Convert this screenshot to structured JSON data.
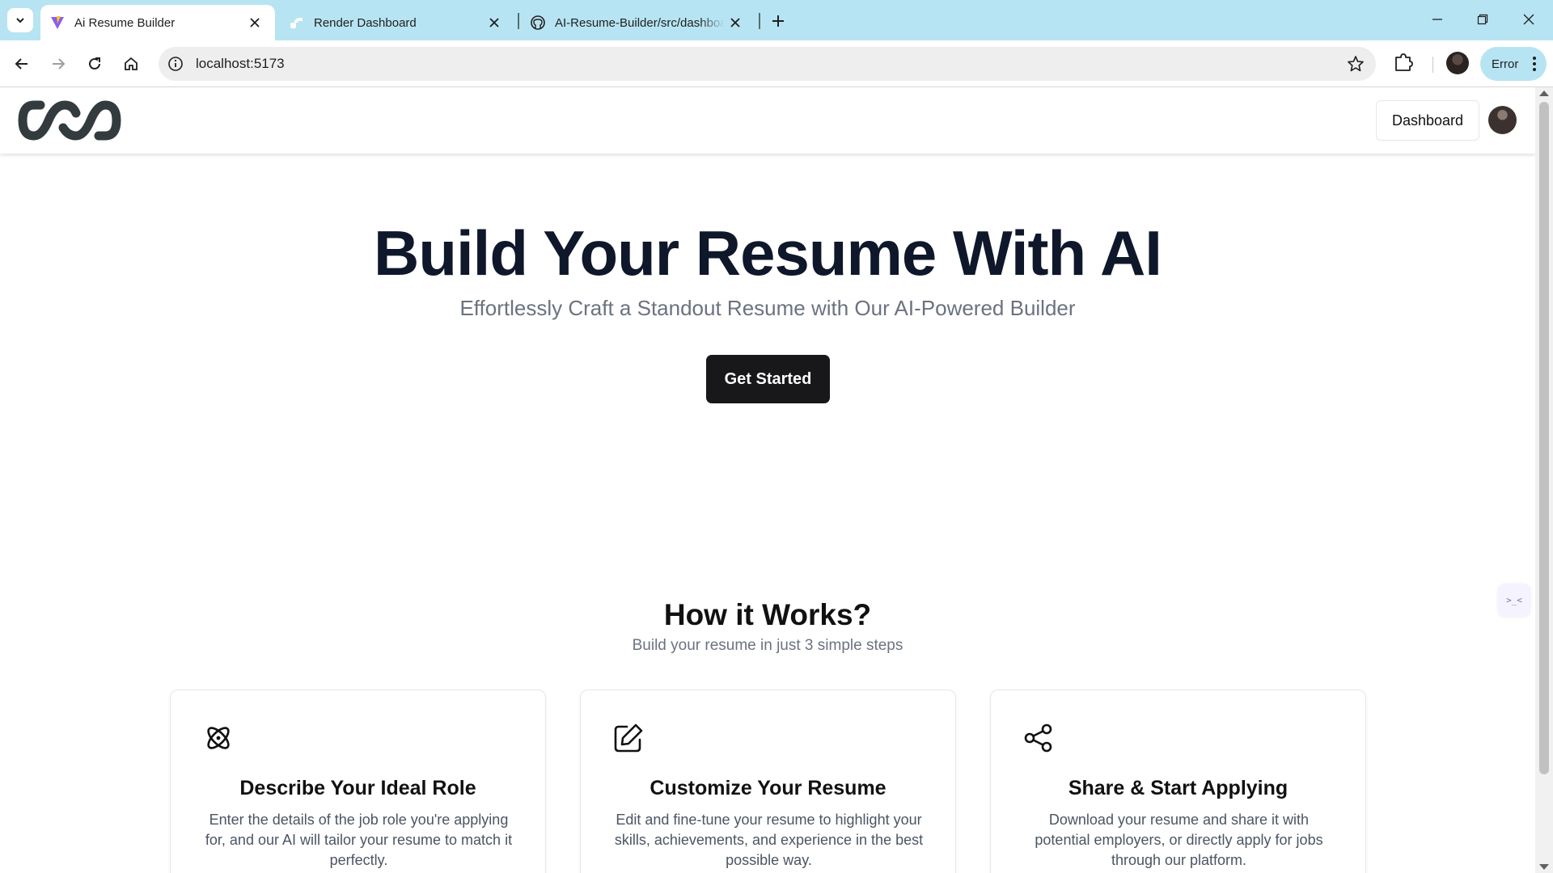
{
  "browser": {
    "tabs": [
      {
        "title": "Ai Resume Builder",
        "active": true,
        "icon": "vite-favicon"
      },
      {
        "title": "Render Dashboard",
        "active": false,
        "icon": "render-favicon"
      },
      {
        "title": "AI-Resume-Builder/src/dashboard",
        "active": false,
        "icon": "github-favicon"
      }
    ],
    "url": "localhost:5173",
    "error_chip": "Error",
    "colors": {
      "tabbar": "#b7e4f2",
      "omnibox": "#eeeeee"
    }
  },
  "header": {
    "dashboard_label": "Dashboard"
  },
  "hero": {
    "title": "Build Your Resume With AI",
    "subtitle": "Effortlessly Craft a Standout Resume with Our AI-Powered Builder",
    "cta_label": "Get Started"
  },
  "how_it_works": {
    "title": "How it Works?",
    "subtitle": "Build your resume in just 3 simple steps",
    "cards": [
      {
        "icon": "atom-icon",
        "title": "Describe Your Ideal Role",
        "description": "Enter the details of the job role you're applying for, and our AI will tailor your resume to match it perfectly."
      },
      {
        "icon": "edit-icon",
        "title": "Customize Your Resume",
        "description": "Edit and fine-tune your resume to highlight your skills, achievements, and experience in the best possible way."
      },
      {
        "icon": "share-icon",
        "title": "Share & Start Applying",
        "description": "Download your resume and share it with potential employers, or directly apply for jobs through our platform."
      }
    ]
  },
  "widget": {
    "label": ">_<"
  }
}
